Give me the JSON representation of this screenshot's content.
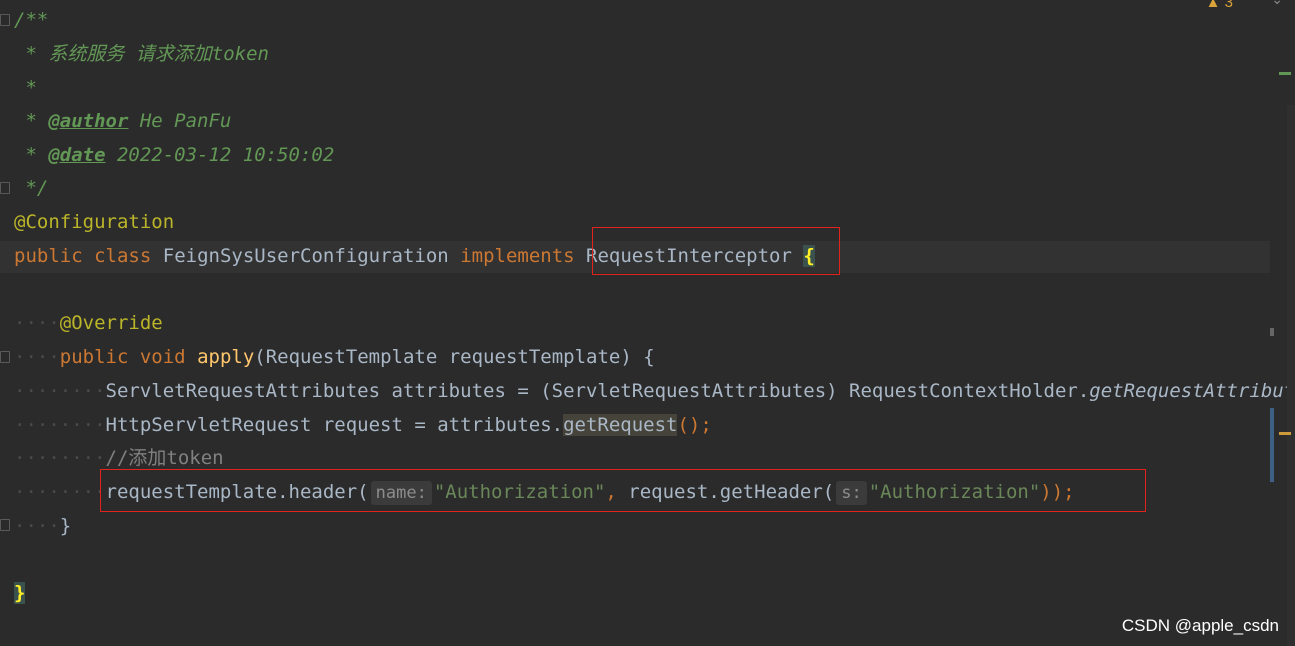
{
  "editor": {
    "language": "java",
    "inspection": {
      "warning_count": "3"
    },
    "lines": {
      "l1": "/**",
      "l2": " * 系统服务 请求添加token",
      "l3": " *",
      "l4_prefix": " * ",
      "l4_tag": "@author",
      "l4_value": " He PanFu",
      "l5_prefix": " * ",
      "l5_tag": "@date",
      "l5_value": " 2022-03-12 10:50:02",
      "l6": " */",
      "l7": "@Configuration",
      "l8_kw1": "public",
      "l8_kw2": "class",
      "l8_name": "FeignSysUserConfiguration",
      "l8_kw3": "implements",
      "l8_iface": "RequestInterceptor",
      "l8_brace": "{",
      "l10": "@Override",
      "l11_kw1": "public",
      "l11_kw2": "void",
      "l11_fn": "apply",
      "l11_params": "(RequestTemplate requestTemplate)",
      "l11_brace": "{",
      "l12_a": "ServletRequestAttributes attributes = (ServletRequestAttributes) RequestContextHolder.",
      "l12_b": "getRequestAttributes",
      "l13_a": "HttpServletRequest request = attributes.",
      "l13_b": "getRequest",
      "l13_c": "();",
      "l14": "//添加token",
      "l15_a": "requestTemplate.header(",
      "l15_hint1": "name:",
      "l15_str1": "\"Authorization\"",
      "l15_b": ", ",
      "l15_c": "request.getHeader(",
      "l15_hint2": "s:",
      "l15_str2": "\"Authorization\"",
      "l15_d": "));",
      "l16": "}",
      "l18": "}"
    }
  },
  "watermark": "CSDN @apple_csdn",
  "colors": {
    "background": "#2b2b2b",
    "keyword": "#cc7832",
    "annotation": "#bbb529",
    "string": "#6a8759",
    "doc_comment": "#629755",
    "method": "#ffc66d",
    "highlight_box": "#e0241c"
  }
}
